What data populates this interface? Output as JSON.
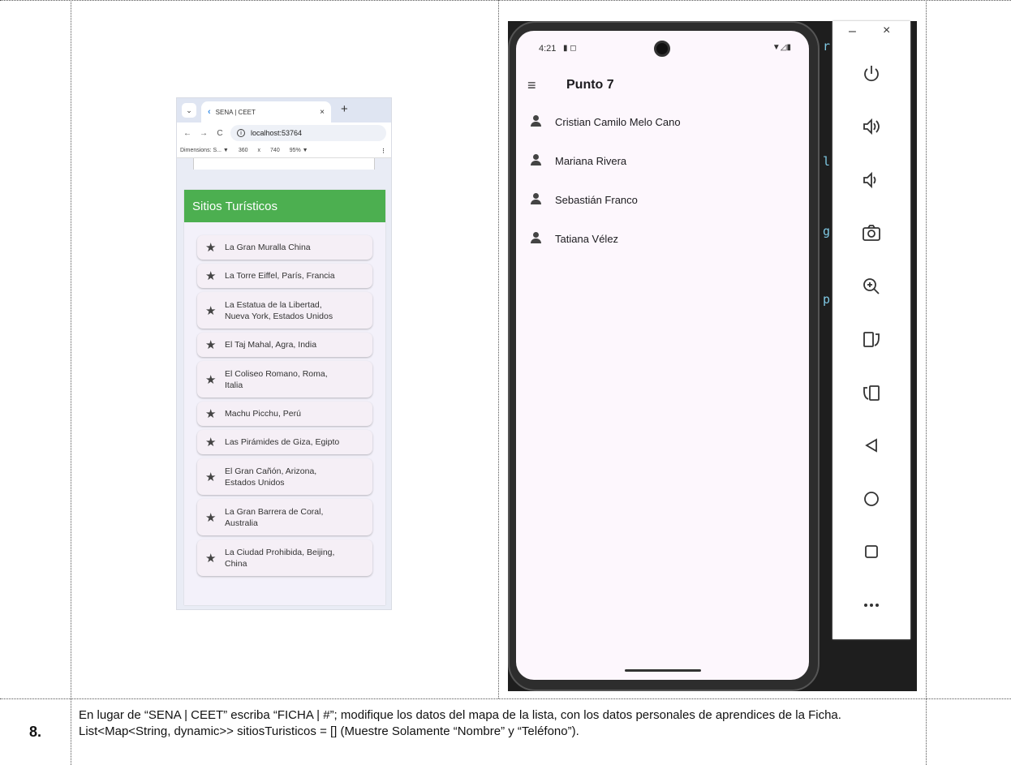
{
  "document": {
    "row_number": "8.",
    "instruction": "En lugar de “SENA | CEET” escriba “FICHA | #”; modifique los datos del mapa de la lista, con los datos personales de aprendices de la Ficha. List<Map<String, dynamic>> sitiosTuristicos = [] (Muestre Solamente “Nombre” y “Teléfono”)."
  },
  "browser": {
    "tab_title": "SENA | CEET",
    "tab_close": "×",
    "new_tab": "+",
    "tab_dropdown": "⌄",
    "back": "←",
    "forward": "→",
    "reload": "C",
    "url": "localhost:53764",
    "dimensions_label": "Dimensions: S... ▼",
    "width": "360",
    "times": "x",
    "height": "740",
    "zoom": "95% ▼",
    "kebab": "⋮",
    "app_title": "Sitios Turísticos",
    "sites": [
      "La Gran Muralla China",
      "La Torre Eiffel, París, Francia",
      "La Estatua de la Libertad, Nueva York, Estados Unidos",
      "El Taj Mahal, Agra, India",
      "El Coliseo Romano, Roma, Italia",
      "Machu Picchu, Perú",
      "Las Pirámides de Giza, Egipto",
      "El Gran Cañón, Arizona, Estados Unidos",
      "La Gran Barrera de Coral, Australia",
      "La Ciudad Prohibida, Beijing, China"
    ]
  },
  "phone": {
    "time": "4:21",
    "title": "Punto 7",
    "people": [
      "Cristian Camilo Melo Cano",
      "Mariana Rivera",
      "Sebastián Franco",
      "Tatiana Vélez"
    ]
  },
  "emulator_panel": {
    "minimize": "–",
    "close": "×"
  },
  "colors": {
    "app_bar_green": "#4caf50",
    "phone_screen": "#fdf7fd",
    "emulator_dark": "#1e1e1e"
  }
}
